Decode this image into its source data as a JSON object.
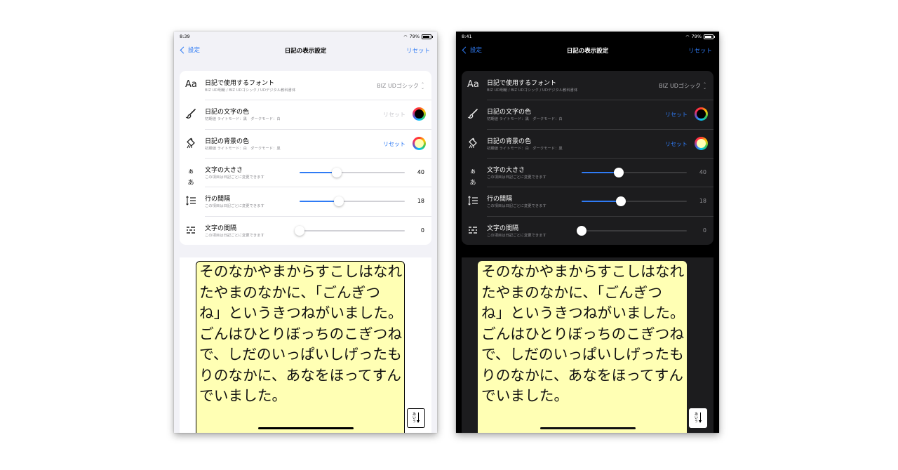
{
  "screens": [
    {
      "theme": "light",
      "status": {
        "time": "8:39",
        "battery": "79%"
      },
      "nav": {
        "back_label": "設定",
        "title": "日記の表示設定",
        "reset_label": "リセット"
      },
      "font_row": {
        "title": "日記で使用するフォント",
        "subtitle": "BIZ UD明朝 / BIZ UDゴシック / UDデジタル教科書体",
        "value": "BIZ UDゴシック"
      },
      "text_color_row": {
        "title": "日記の文字の色",
        "subtitle": "初期値 ライトモード：黒　ダークモード：白",
        "reset_label": "リセット",
        "reset_enabled": false,
        "color": "#000000"
      },
      "bg_color_row": {
        "title": "日記の背景の色",
        "subtitle": "初期値 ライトモード：白　ダークモード：黒",
        "reset_label": "リセット",
        "reset_enabled": true,
        "color": "#ffffb4"
      },
      "size_row": {
        "title": "文字の大きさ",
        "subtitle": "この項目は日記ごとに変更できます",
        "value": "40",
        "level": 0.35
      },
      "line_row": {
        "title": "行の間隔",
        "subtitle": "この項目は日記ごとに変更できます",
        "value": "18",
        "level": 0.37
      },
      "spacing_row": {
        "title": "文字の間隔",
        "subtitle": "この項目は日記ごとに変更できます",
        "value": "0",
        "level": 0.0
      },
      "preview": {
        "lines": [
          "そのなかやまからすこしはなれ",
          "たやまのなかに、「ごんぎつ",
          "ね」というきつねがいました。",
          "ごんはひとりぼっちのこぎつね",
          "で、しだのいっぱいしげったも",
          "りのなかに、あなをほってすん",
          "でいました。"
        ],
        "orientation_label": "あいう"
      }
    },
    {
      "theme": "dark",
      "status": {
        "time": "8:41",
        "battery": "79%"
      },
      "nav": {
        "back_label": "設定",
        "title": "日記の表示設定",
        "reset_label": "リセット"
      },
      "font_row": {
        "title": "日記で使用するフォント",
        "subtitle": "BIZ UD明朝 / BIZ UDゴシック / UDデジタル教科書体",
        "value": "BIZ UDゴシック"
      },
      "text_color_row": {
        "title": "日記の文字の色",
        "subtitle": "初期値 ライトモード：黒　ダークモード：白",
        "reset_label": "リセット",
        "reset_enabled": true,
        "color": "#000000"
      },
      "bg_color_row": {
        "title": "日記の背景の色",
        "subtitle": "初期値 ライトモード：白　ダークモード：黒",
        "reset_label": "リセット",
        "reset_enabled": true,
        "color": "#ffffb4"
      },
      "size_row": {
        "title": "文字の大きさ",
        "subtitle": "この項目は日記ごとに変更できます",
        "value": "40",
        "level": 0.35
      },
      "line_row": {
        "title": "行の間隔",
        "subtitle": "この項目は日記ごとに変更できます",
        "value": "18",
        "level": 0.37
      },
      "spacing_row": {
        "title": "文字の間隔",
        "subtitle": "この項目は日記ごとに変更できます",
        "value": "0",
        "level": 0.0
      },
      "preview": {
        "lines": [
          "そのなかやまからすこしはなれ",
          "たやまのなかに、「ごんぎつ",
          "ね」というきつねがいました。",
          "ごんはひとりぼっちのこぎつね",
          "で、しだのいっぱいしげったも",
          "りのなかに、あなをほってすん",
          "でいました。"
        ],
        "orientation_label": "あいう"
      }
    }
  ],
  "colors": {
    "accent": "#2f7bf5",
    "paper": "#ffffb4"
  }
}
